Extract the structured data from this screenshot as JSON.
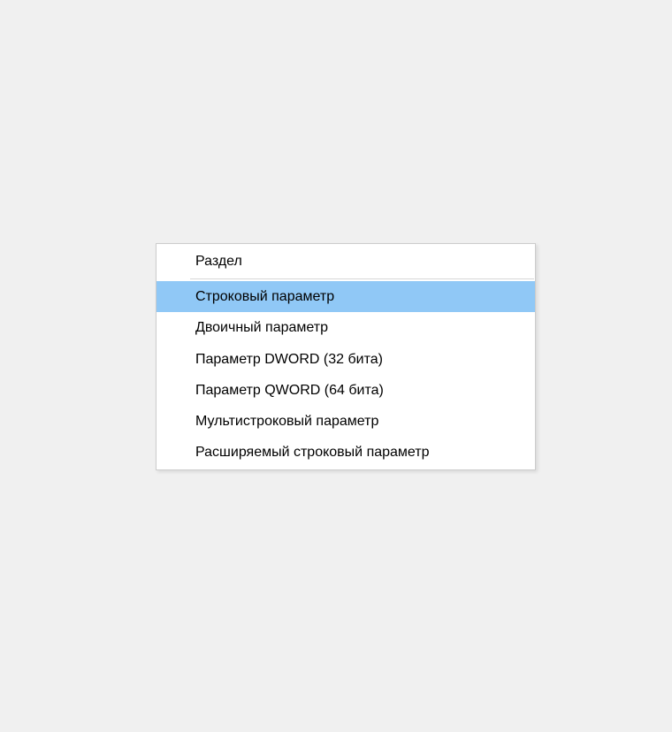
{
  "contextMenu": {
    "items": [
      {
        "label": "Раздел",
        "highlighted": false
      },
      {
        "separator": true
      },
      {
        "label": "Строковый параметр",
        "highlighted": true
      },
      {
        "label": "Двоичный параметр",
        "highlighted": false
      },
      {
        "label": "Параметр DWORD (32 бита)",
        "highlighted": false
      },
      {
        "label": "Параметр QWORD (64 бита)",
        "highlighted": false
      },
      {
        "label": "Мультистроковый параметр",
        "highlighted": false
      },
      {
        "label": "Расширяемый строковый параметр",
        "highlighted": false
      }
    ]
  }
}
